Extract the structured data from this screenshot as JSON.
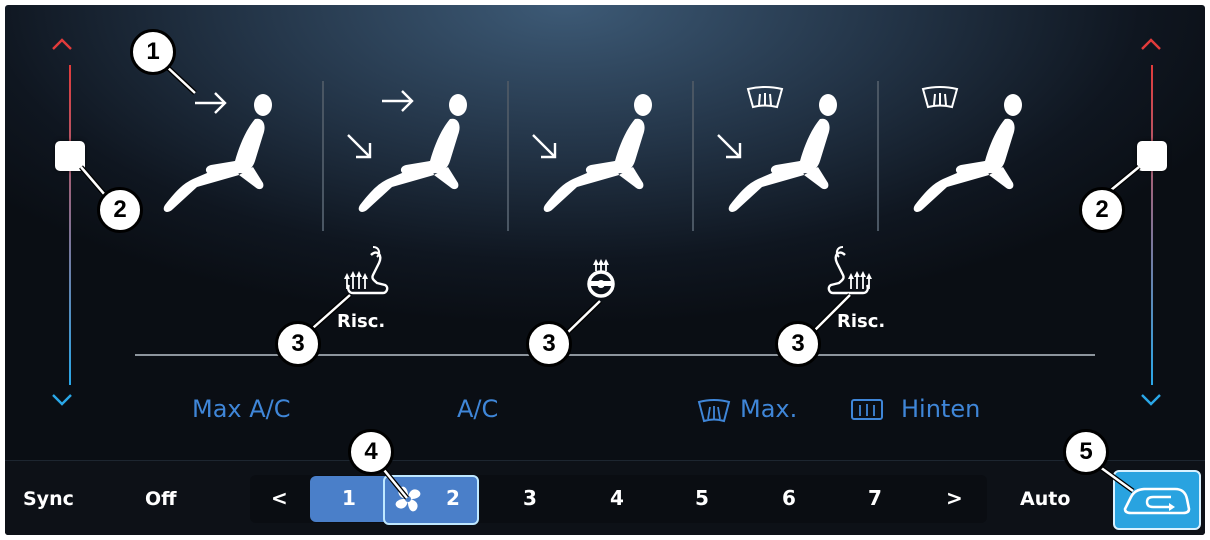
{
  "colors": {
    "accent_blue": "#3f86d8",
    "fan_selected": "#4a7fc9",
    "auto_active": "#29a3e0",
    "slider_hot": "#e23b3b",
    "slider_cold": "#2aa7e8"
  },
  "sliders": {
    "left": {
      "up_icon": "chevron-up-icon",
      "down_icon": "chevron-down-icon",
      "level": 0.72
    },
    "right": {
      "up_icon": "chevron-up-icon",
      "down_icon": "chevron-down-icon",
      "level": 0.72
    }
  },
  "airflow_modes": [
    {
      "icons": [
        "arrow-right-icon",
        "seated-person-icon"
      ]
    },
    {
      "icons": [
        "arrow-right-icon",
        "arrow-down-right-icon",
        "seated-person-icon"
      ]
    },
    {
      "icons": [
        "arrow-down-right-icon",
        "seated-person-icon"
      ]
    },
    {
      "icons": [
        "windshield-defrost-icon",
        "arrow-down-right-icon",
        "seated-person-icon"
      ]
    },
    {
      "icons": [
        "windshield-defrost-icon",
        "seated-person-icon"
      ]
    }
  ],
  "heaters": {
    "left_seat": {
      "icon": "seat-heater-icon",
      "label": "Risc."
    },
    "steering_wheel": {
      "icon": "steering-wheel-heater-icon"
    },
    "right_seat": {
      "icon": "seat-heater-icon",
      "label": "Risc."
    }
  },
  "functions": {
    "max_ac": "Max A/C",
    "ac": "A/C",
    "max_defrost": "Max.",
    "max_defrost_icon": "windshield-defrost-icon",
    "rear_defrost": "Hinten",
    "rear_defrost_icon": "rear-defrost-icon"
  },
  "bottom_bar": {
    "sync": "Sync",
    "off": "Off",
    "prev": "<",
    "next": ">",
    "fan_levels": [
      "1",
      "2",
      "3",
      "4",
      "5",
      "6",
      "7"
    ],
    "selected_level": "2",
    "fan_icon": "fan-icon",
    "auto": "Auto",
    "recirc_icon": "air-recirculation-icon"
  },
  "callouts": {
    "c1": "1",
    "c2_left": "2",
    "c2_right": "2",
    "c3_left": "3",
    "c3_center": "3",
    "c3_right": "3",
    "c4": "4",
    "c5": "5"
  }
}
